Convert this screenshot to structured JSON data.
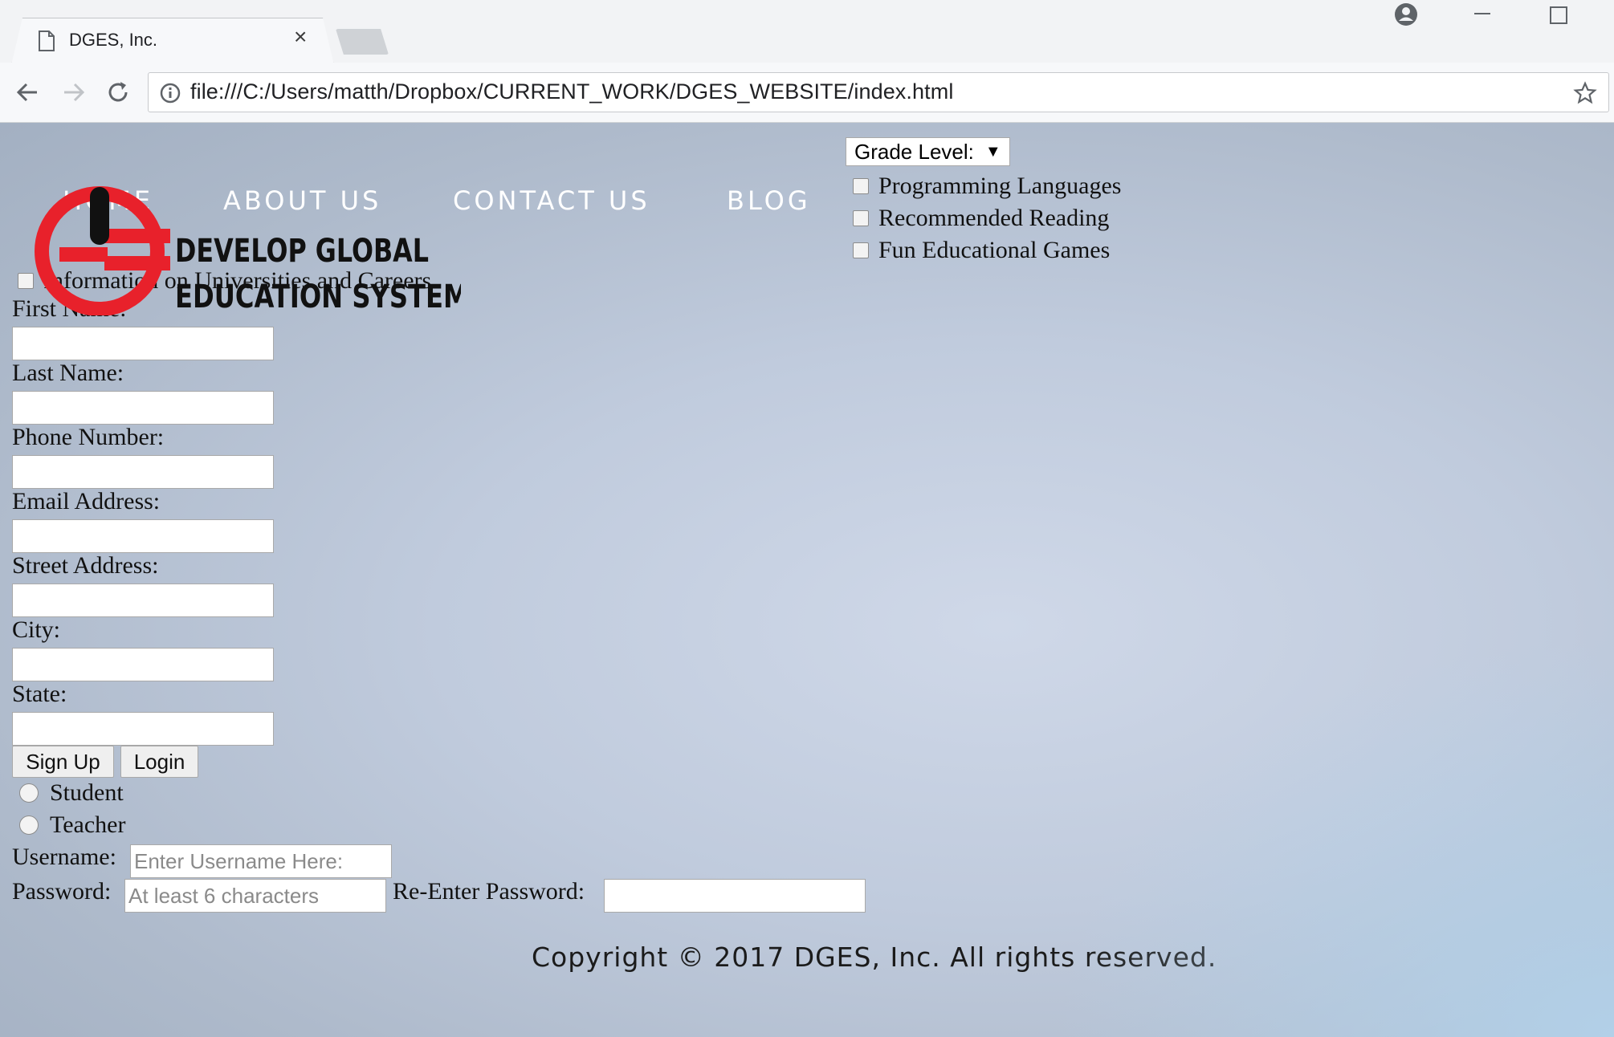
{
  "browser": {
    "tab_title": "DGES, Inc.",
    "url": "file:///C:/Users/matth/Dropbox/CURRENT_WORK/DGES_WEBSITE/index.html"
  },
  "nav": {
    "items": [
      "HOME",
      "ABOUT US",
      "CONTACT US",
      "BLOG"
    ]
  },
  "logo": {
    "line1": "DEVELOP GLOBAL",
    "line2": "EDUCATION SYSTEM"
  },
  "grade_select": {
    "selected": "Grade Level:"
  },
  "interests": [
    "Programming Languages",
    "Recommended Reading",
    "Fun Educational Games",
    "Information on Universities and Careers"
  ],
  "form": {
    "fields": [
      "First Name:",
      "Last Name:",
      "Phone Number:",
      "Email Address:",
      "Street Address:",
      "City:",
      "State:"
    ],
    "signup_label": "Sign Up",
    "login_label": "Login",
    "roles": [
      "Student",
      "Teacher"
    ],
    "username_label": "Username:",
    "username_placeholder": "Enter Username Here:",
    "password_label": "Password:",
    "password_placeholder": "At least 6 characters",
    "reenter_label": "Re-Enter Password:"
  },
  "footer": {
    "copyright": "Copyright © 2017 DGES, Inc. All rights reserved."
  },
  "colors": {
    "logo_red": "#e8212b",
    "nav_text": "#ffffff"
  }
}
